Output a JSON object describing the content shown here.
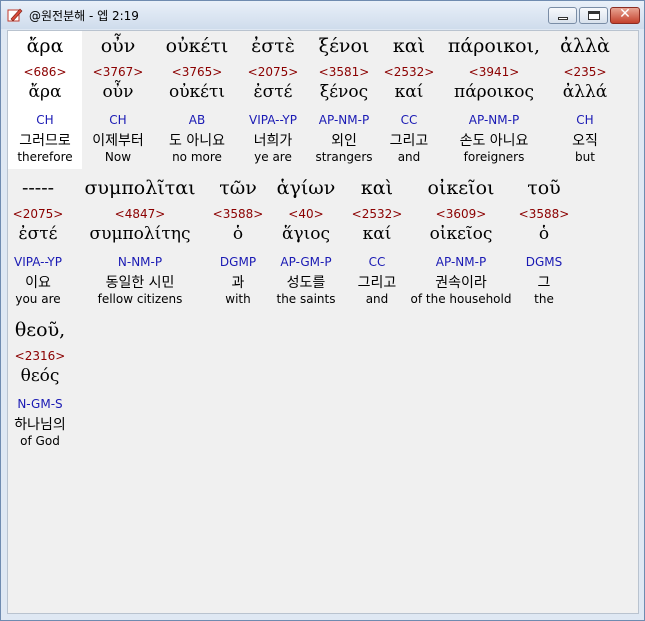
{
  "window": {
    "title": "@원전분해 - 엡 2:19"
  },
  "words": [
    {
      "greek": "ἄρα",
      "strong": "<686>",
      "lemma": "ἄρα",
      "morph": "CH",
      "korean": "그러므로",
      "english": "therefore"
    },
    {
      "greek": "οὖν",
      "strong": "<3767>",
      "lemma": "οὖν",
      "morph": "CH",
      "korean": "이제부터",
      "english": "Now"
    },
    {
      "greek": "οὐκέτι",
      "strong": "<3765>",
      "lemma": "οὐκέτι",
      "morph": "AB",
      "korean": "도 아니요",
      "english": "no more"
    },
    {
      "greek": "ἐστὲ",
      "strong": "<2075>",
      "lemma": "ἐστέ",
      "morph": "VIPA--YP",
      "korean": "너희가",
      "english": "ye are"
    },
    {
      "greek": "ξένοι",
      "strong": "<3581>",
      "lemma": "ξένος",
      "morph": "AP-NM-P",
      "korean": "외인",
      "english": "strangers"
    },
    {
      "greek": "καὶ",
      "strong": "<2532>",
      "lemma": "καί",
      "morph": "CC",
      "korean": "그리고",
      "english": "and"
    },
    {
      "greek": "πάροικοι,",
      "strong": "<3941>",
      "lemma": "πάροικος",
      "morph": "AP-NM-P",
      "korean": "손도 아니요",
      "english": "foreigners"
    },
    {
      "greek": "ἀλλὰ",
      "strong": "<235>",
      "lemma": "ἀλλά",
      "morph": "CH",
      "korean": "오직",
      "english": "but"
    },
    {
      "greek": "-----",
      "strong": "<2075>",
      "lemma": "ἐστέ",
      "morph": "VIPA--YP",
      "korean": "이요",
      "english": "you are"
    },
    {
      "greek": "συμπολῖται",
      "strong": "<4847>",
      "lemma": "συμπολίτης",
      "morph": "N-NM-P",
      "korean": "동일한 시민",
      "english": "fellow citizens"
    },
    {
      "greek": "τῶν",
      "strong": "<3588>",
      "lemma": "ὁ",
      "morph": "DGMP",
      "korean": "과",
      "english": "with"
    },
    {
      "greek": "ἁγίων",
      "strong": "<40>",
      "lemma": "ἅγιος",
      "morph": "AP-GM-P",
      "korean": "성도를",
      "english": "the saints"
    },
    {
      "greek": "καὶ",
      "strong": "<2532>",
      "lemma": "καί",
      "morph": "CC",
      "korean": "그리고",
      "english": "and"
    },
    {
      "greek": "οἰκεῖοι",
      "strong": "<3609>",
      "lemma": "οἰκεῖος",
      "morph": "AP-NM-P",
      "korean": "권속이라",
      "english": "of the household"
    },
    {
      "greek": "τοῦ",
      "strong": "<3588>",
      "lemma": "ὁ",
      "morph": "DGMS",
      "korean": "그",
      "english": "the"
    },
    {
      "greek": "θεοῦ,",
      "strong": "<2316>",
      "lemma": "θεός",
      "morph": "N-GM-S",
      "korean": "하나님의",
      "english": "of God"
    }
  ]
}
